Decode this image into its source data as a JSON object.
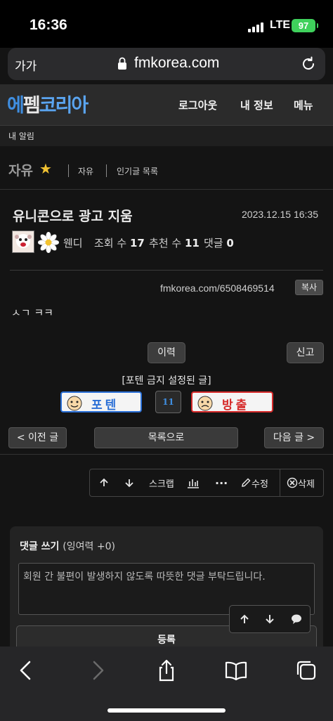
{
  "status_bar": {
    "time": "16:36",
    "network": "LTE",
    "battery": "97"
  },
  "browser": {
    "text_size": "가가",
    "url": "fmkorea.com"
  },
  "site": {
    "logo": [
      "에",
      "펨",
      "코",
      "리",
      "아"
    ],
    "nav": [
      "로그아웃",
      "내 정보",
      "메뉴"
    ]
  },
  "notifications": {
    "label": "내 알림"
  },
  "board": {
    "title": "자유",
    "links": [
      "자유",
      "인기글 목록"
    ]
  },
  "post": {
    "title": "유니콘으로 광고 지움",
    "date": "2023.12.15 16:35",
    "author": "웬디",
    "views_label": "조회 수",
    "views": "17",
    "votes_label": "추천 수",
    "votes": "11",
    "comments_label": "댓글",
    "comments": "0",
    "short_url": "fmkorea.com/6508469514",
    "copy_label": "복사",
    "body": "ㅅㄱ ㅋㅋ"
  },
  "actions": {
    "history": "이력",
    "report": "신고",
    "restriction_notice": "[포텐 금지 설정된 글]",
    "upvote": "포텐",
    "downvote": "방출",
    "score": "11"
  },
  "post_nav": {
    "prev": "< 이전 글",
    "list": "목록으로",
    "next": "다음 글 >"
  },
  "toolbar": {
    "scrap": "스크랩",
    "edit": "수정",
    "delete": "삭제"
  },
  "comment": {
    "title": "댓글 쓰기",
    "remaining": "(잉여력 +0)",
    "placeholder": "회원 간 불편이 발생하지 않도록 따뜻한 댓글 부탁드립니다.",
    "submit": "등록"
  },
  "colors": {
    "accent": "#3f8ee0",
    "upvote": "#2a6fd6",
    "downvote": "#d62a2a",
    "battery": "#3fd15c"
  },
  "icons": [
    "back-icon",
    "forward-icon",
    "share-icon",
    "bookmarks-icon",
    "tabs-icon"
  ]
}
